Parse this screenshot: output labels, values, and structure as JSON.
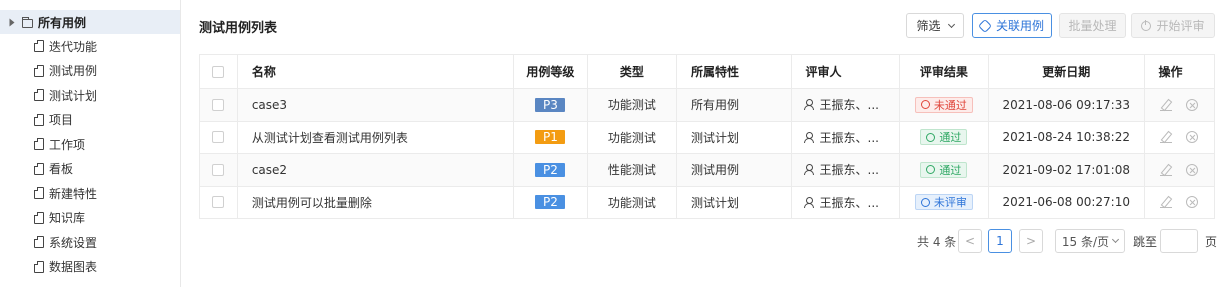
{
  "sidebar": {
    "root_label": "所有用例",
    "items": [
      {
        "label": "迭代功能"
      },
      {
        "label": "测试用例"
      },
      {
        "label": "测试计划"
      },
      {
        "label": "项目"
      },
      {
        "label": "工作项"
      },
      {
        "label": "看板"
      },
      {
        "label": "新建特性"
      },
      {
        "label": "知识库"
      },
      {
        "label": "系统设置"
      },
      {
        "label": "数据图表"
      }
    ]
  },
  "header": {
    "title": "测试用例列表",
    "filter_label": "筛选",
    "link_label": "关联用例",
    "batch_label": "批量处理",
    "review_label": "开始评审"
  },
  "table": {
    "columns": [
      "名称",
      "用例等级",
      "类型",
      "所属特性",
      "评审人",
      "评审结果",
      "更新日期",
      "操作"
    ],
    "rows": [
      {
        "name": "case3",
        "level": "P3",
        "level_color": "#5a86c2",
        "type": "功能测试",
        "feature": "所有用例",
        "reviewer": "王振东、...",
        "result": "未通过",
        "result_kind": "fail",
        "date": "2021-08-06 09:17:33"
      },
      {
        "name": "从测试计划查看测试用例列表",
        "level": "P1",
        "level_color": "#f39c12",
        "type": "功能测试",
        "feature": "测试计划",
        "reviewer": "王振东、...",
        "result": "通过",
        "result_kind": "pass",
        "date": "2021-08-24 10:38:22"
      },
      {
        "name": "case2",
        "level": "P2",
        "level_color": "#4a90e2",
        "type": "性能测试",
        "feature": "测试用例",
        "reviewer": "王振东、...",
        "result": "通过",
        "result_kind": "pass",
        "date": "2021-09-02 17:01:08"
      },
      {
        "name": "测试用例可以批量删除",
        "level": "P2",
        "level_color": "#4a90e2",
        "type": "功能测试",
        "feature": "测试计划",
        "reviewer": "王振东、...",
        "result": "未评审",
        "result_kind": "none",
        "date": "2021-06-08 00:27:10"
      }
    ]
  },
  "pagination": {
    "total_text": "共 4 条",
    "current_page": "1",
    "page_size": "15 条/页",
    "jump_label": "跳至",
    "page_label": "页",
    "prev": "<",
    "next": ">"
  }
}
